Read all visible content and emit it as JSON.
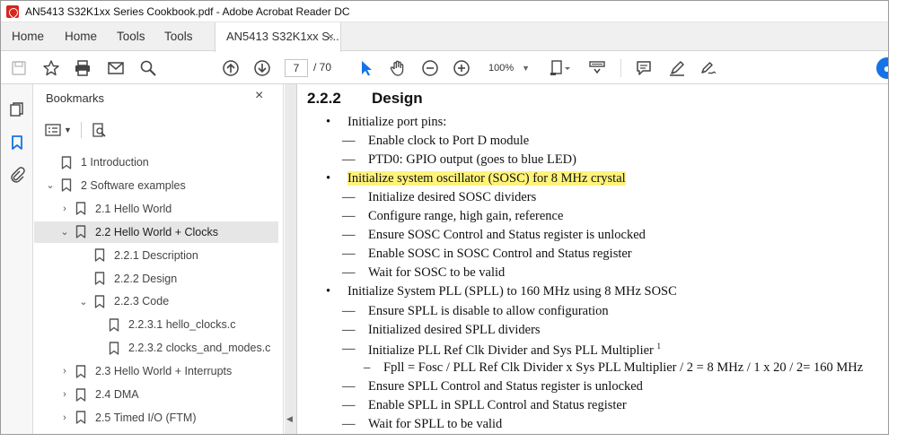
{
  "window": {
    "title": "AN5413 S32K1xx Series Cookbook.pdf - Adobe Acrobat Reader DC"
  },
  "tabs": {
    "nav": [
      "Home",
      "Home",
      "Tools",
      "Tools"
    ],
    "document_tab": "AN5413 S32K1xx S...",
    "close": "×"
  },
  "toolbar": {
    "page_current": "7",
    "page_total": "/ 70",
    "zoom": "100%"
  },
  "bookmarks": {
    "title": "Bookmarks",
    "close": "×",
    "items": [
      {
        "label": "1 Introduction",
        "level": 0,
        "twisty": ""
      },
      {
        "label": "2 Software examples",
        "level": 0,
        "twisty": "⌄"
      },
      {
        "label": "2.1 Hello World",
        "level": 1,
        "twisty": "›"
      },
      {
        "label": "2.2 Hello World + Clocks",
        "level": 1,
        "twisty": "⌄",
        "selected": true
      },
      {
        "label": "2.2.1 Description",
        "level": 2,
        "twisty": ""
      },
      {
        "label": "2.2.2 Design",
        "level": 2,
        "twisty": ""
      },
      {
        "label": "2.2.3 Code",
        "level": 2,
        "twisty": "⌄"
      },
      {
        "label": "2.2.3.1 hello_clocks.c",
        "level": 3,
        "twisty": ""
      },
      {
        "label": "2.2.3.2 clocks_and_modes.c",
        "level": 3,
        "twisty": ""
      },
      {
        "label": "2.3 Hello World + Interrupts",
        "level": 1,
        "twisty": "›"
      },
      {
        "label": "2.4 DMA",
        "level": 1,
        "twisty": "›"
      },
      {
        "label": "2.5 Timed I/O (FTM)",
        "level": 1,
        "twisty": "›"
      }
    ]
  },
  "document": {
    "section_number": "2.2.2",
    "section_title": "Design",
    "lines": [
      {
        "mark": "•",
        "text": "Initialize port pins:",
        "indent": 1
      },
      {
        "mark": "—",
        "text": "Enable clock to Port D module",
        "indent": 2
      },
      {
        "mark": "—",
        "text": "PTD0: GPIO output (goes to blue LED)",
        "indent": 2
      },
      {
        "mark": "•",
        "text": "Initialize system oscillator (SOSC) for 8 MHz crystal",
        "indent": 1,
        "highlight": true
      },
      {
        "mark": "—",
        "text": "Initialize desired SOSC dividers",
        "indent": 2
      },
      {
        "mark": "—",
        "text": "Configure range, high gain, reference",
        "indent": 2
      },
      {
        "mark": "—",
        "text": "Ensure SOSC Control and Status register is unlocked",
        "indent": 2
      },
      {
        "mark": "—",
        "text": "Enable SOSC in SOSC Control and Status register",
        "indent": 2
      },
      {
        "mark": "—",
        "text": "Wait for SOSC to be valid",
        "indent": 2
      },
      {
        "mark": "•",
        "text": "Initialize System PLL (SPLL) to 160 MHz using 8 MHz SOSC",
        "indent": 1
      },
      {
        "mark": "—",
        "text": "Ensure SPLL is disable to allow configuration",
        "indent": 2
      },
      {
        "mark": "—",
        "text": "Initialized desired SPLL dividers",
        "indent": 2
      },
      {
        "mark": "—",
        "text": "Initialize PLL Ref Clk Divider and Sys PLL Multiplier",
        "indent": 2,
        "sup": "1"
      },
      {
        "mark": "–",
        "text": "Fpll = Fosc / PLL Ref Clk Divider x Sys PLL Multiplier / 2 = 8 MHz / 1 x 20 / 2= 160 MHz",
        "indent": 3
      },
      {
        "mark": "—",
        "text": "Ensure SPLL Control and Status register is unlocked",
        "indent": 2
      },
      {
        "mark": "—",
        "text": "Enable SPLL in SPLL Control and Status register",
        "indent": 2
      },
      {
        "mark": "—",
        "text": "Wait for SPLL to be valid",
        "indent": 2
      }
    ]
  }
}
